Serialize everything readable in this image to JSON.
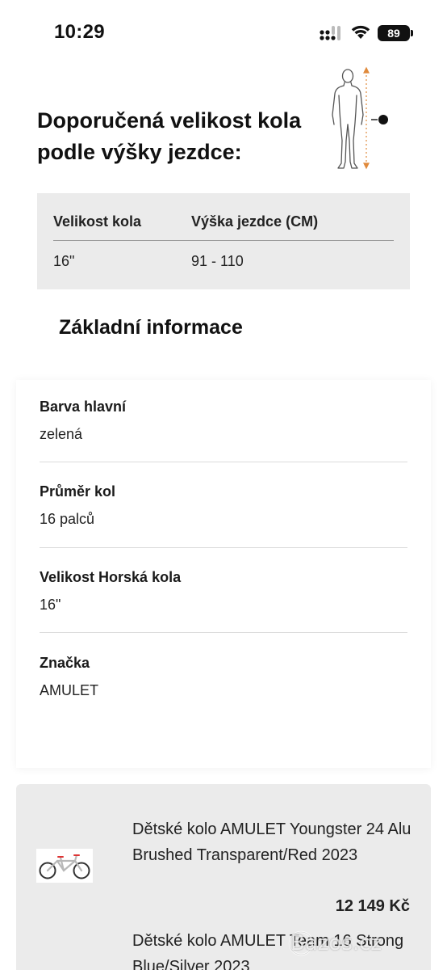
{
  "status_bar": {
    "time": "10:29",
    "battery": "89"
  },
  "size_guide": {
    "heading": "Doporučená velikost kola podle výšky jezdce:",
    "table": {
      "headers": [
        "Velikost kola",
        "Výška jezdce (CM)"
      ],
      "rows": [
        [
          "16\"",
          "91 - 110"
        ]
      ]
    }
  },
  "basic_info": {
    "heading": "Základní informace",
    "items": [
      {
        "label": "Barva hlavní",
        "value": "zelená"
      },
      {
        "label": "Průměr kol",
        "value": "16 palců"
      },
      {
        "label": "Velikost Horská kola",
        "value": "16\""
      },
      {
        "label": "Značka",
        "value": "AMULET"
      }
    ]
  },
  "products": [
    {
      "name": "Dětské kolo AMULET Youngster 24 Alu Brushed Transparent/Red 2023",
      "price": "12 149 Kč"
    },
    {
      "name": "Dětské kolo AMULET Team 16 Strong Blue/Silver 2023",
      "price": ""
    }
  ],
  "watermark": "Bazos.cz",
  "colors": {
    "table_bg": "#ebebeb",
    "text": "#111111",
    "marker": "#111111",
    "figure_arrow": "#e08a3c"
  },
  "icons": [
    "signal-icon",
    "wifi-icon",
    "battery-icon",
    "body-height-figure-icon",
    "bike-thumbnail-icon"
  ]
}
